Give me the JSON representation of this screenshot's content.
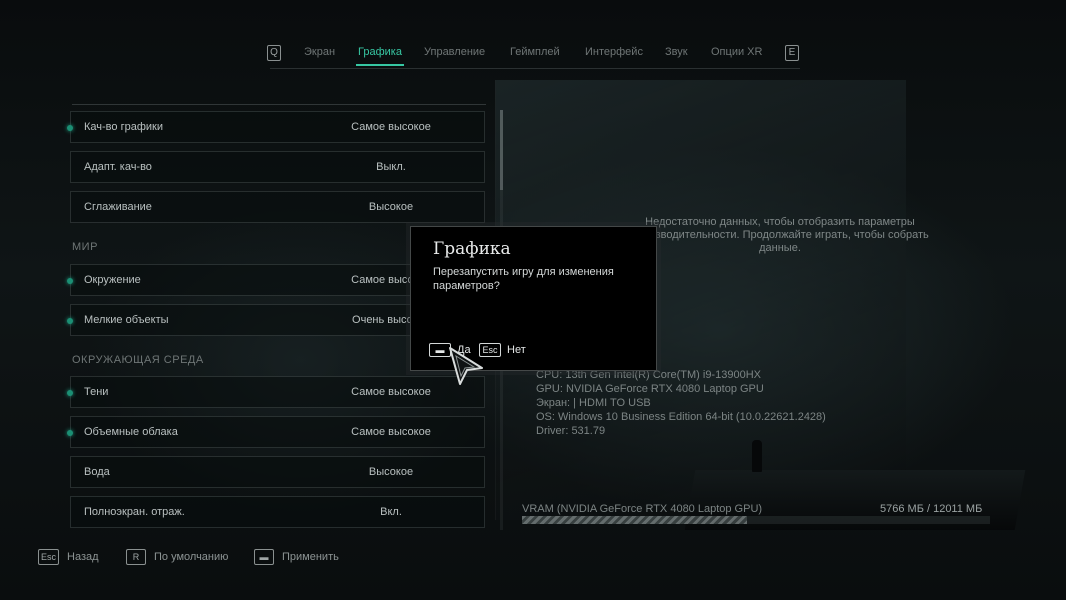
{
  "nav": {
    "prev_key": "Q",
    "next_key": "E",
    "tabs": [
      {
        "label": "Экран",
        "active": false
      },
      {
        "label": "Графика",
        "active": true
      },
      {
        "label": "Управление",
        "active": false
      },
      {
        "label": "Геймплей",
        "active": false
      },
      {
        "label": "Интерфейс",
        "active": false
      },
      {
        "label": "Звук",
        "active": false
      },
      {
        "label": "Опции XR",
        "active": false
      }
    ]
  },
  "settings": {
    "rows": [
      {
        "label": "Кач-во графики",
        "value": "Самое высокое"
      },
      {
        "label": "Адапт. кач-во",
        "value": "Выкл."
      },
      {
        "label": "Сглаживание",
        "value": "Высокое"
      },
      {
        "label": "Окружение",
        "value": "Самое высокое"
      },
      {
        "label": "Мелкие объекты",
        "value": "Очень высокое"
      },
      {
        "label": "Тени",
        "value": "Самое высокое"
      },
      {
        "label": "Объемные облака",
        "value": "Самое высокое"
      },
      {
        "label": "Вода",
        "value": "Высокое"
      },
      {
        "label": "Полноэкран. отраж.",
        "value": "Вкл."
      }
    ],
    "sections": {
      "world": "МИР",
      "environment": "ОКРУЖАЮЩАЯ СРЕДА"
    }
  },
  "info": {
    "message": "Недостаточно данных, чтобы отобразить параметры производительности. Продолжайте играть, чтобы собрать данные.",
    "cpu": "CPU: 13th Gen Intel(R) Core(TM) i9-13900HX",
    "gpu": "GPU: NVIDIA GeForce RTX 4080 Laptop GPU",
    "screen": "Экран:  | HDMI TO USB",
    "os": "OS: Windows 10 Business Edition 64-bit (10.0.22621.2428)",
    "driver": "Driver: 531.79",
    "vram_label": "VRAM (NVIDIA GeForce RTX 4080 Laptop GPU)",
    "vram_value": "5766 МБ / 12011 МБ",
    "vram_fraction": 0.48
  },
  "hints": {
    "back_key": "Esc",
    "back": "Назад",
    "default_key": "R",
    "default": "По умолчанию",
    "apply": "Применить"
  },
  "dialog": {
    "title": "Графика",
    "text": "Перезапустить игру для изменения параметров?",
    "yes": "Да",
    "no_key": "Esc",
    "no": "Нет"
  },
  "colors": {
    "accent": "#37c7a3"
  }
}
